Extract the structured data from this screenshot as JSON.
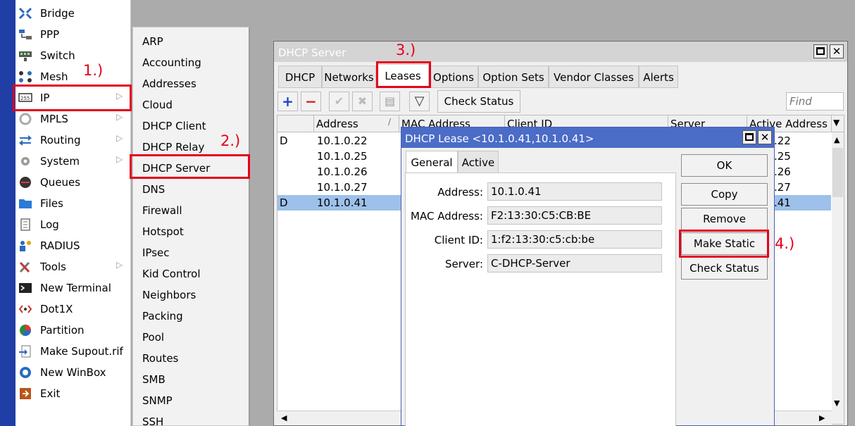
{
  "main_menu": {
    "items": [
      {
        "label": "Bridge",
        "icon": "bridge-icon",
        "submenu": false
      },
      {
        "label": "PPP",
        "icon": "ppp-icon",
        "submenu": false
      },
      {
        "label": "Switch",
        "icon": "switch-icon",
        "submenu": false
      },
      {
        "label": "Mesh",
        "icon": "mesh-icon",
        "submenu": false
      },
      {
        "label": "IP",
        "icon": "ip-icon",
        "submenu": true
      },
      {
        "label": "MPLS",
        "icon": "mpls-icon",
        "submenu": true
      },
      {
        "label": "Routing",
        "icon": "routing-icon",
        "submenu": true
      },
      {
        "label": "System",
        "icon": "gear-icon",
        "submenu": true
      },
      {
        "label": "Queues",
        "icon": "queues-icon",
        "submenu": false
      },
      {
        "label": "Files",
        "icon": "folder-icon",
        "submenu": false
      },
      {
        "label": "Log",
        "icon": "log-icon",
        "submenu": false
      },
      {
        "label": "RADIUS",
        "icon": "radius-icon",
        "submenu": false
      },
      {
        "label": "Tools",
        "icon": "tools-icon",
        "submenu": true
      },
      {
        "label": "New Terminal",
        "icon": "terminal-icon",
        "submenu": false
      },
      {
        "label": "Dot1X",
        "icon": "dot1x-icon",
        "submenu": false
      },
      {
        "label": "Partition",
        "icon": "partition-icon",
        "submenu": false
      },
      {
        "label": "Make Supout.rif",
        "icon": "supout-icon",
        "submenu": false
      },
      {
        "label": "New WinBox",
        "icon": "winbox-icon",
        "submenu": false
      },
      {
        "label": "Exit",
        "icon": "exit-icon",
        "submenu": false
      }
    ],
    "submenu_arrow": "▷"
  },
  "ip_submenu": {
    "items": [
      "ARP",
      "Accounting",
      "Addresses",
      "Cloud",
      "DHCP Client",
      "DHCP Relay",
      "DHCP Server",
      "DNS",
      "Firewall",
      "Hotspot",
      "IPsec",
      "Kid Control",
      "Neighbors",
      "Packing",
      "Pool",
      "Routes",
      "SMB",
      "SNMP",
      "SSH"
    ]
  },
  "dhcp_window": {
    "title": "DHCP Server",
    "tabs": [
      "DHCP",
      "Networks",
      "Leases",
      "Options",
      "Option Sets",
      "Vendor Classes",
      "Alerts"
    ],
    "active_tab": "Leases",
    "toolbar": {
      "add": "+",
      "remove": "−",
      "enable": "✔",
      "disable": "✖",
      "comment": "▤",
      "filter": "▽",
      "check_status": "Check Status",
      "find_placeholder": "Find"
    },
    "columns": [
      "",
      "Address",
      "MAC Address",
      "Client ID",
      "Server",
      "Active Address"
    ],
    "sort_indicator": "/",
    "rows": [
      {
        "flag": "D",
        "address": "10.1.0.22",
        "active": ".22"
      },
      {
        "flag": "",
        "address": "10.1.0.25",
        "active": ".25"
      },
      {
        "flag": "",
        "address": "10.1.0.26",
        "active": ".26"
      },
      {
        "flag": "",
        "address": "10.1.0.27",
        "active": ".27"
      },
      {
        "flag": "D",
        "address": "10.1.0.41",
        "active": ".41"
      }
    ],
    "selected_row": 4
  },
  "lease_dialog": {
    "title": "DHCP Lease <10.1.0.41,10.1.0.41>",
    "tabs": [
      "General",
      "Active"
    ],
    "active_tab": "General",
    "fields": [
      {
        "label": "Address:",
        "value": "10.1.0.41"
      },
      {
        "label": "MAC Address:",
        "value": "F2:13:30:C5:CB:BE"
      },
      {
        "label": "Client ID:",
        "value": "1:f2:13:30:c5:cb:be"
      },
      {
        "label": "Server:",
        "value": "C-DHCP-Server"
      }
    ],
    "buttons": {
      "ok": "OK",
      "copy": "Copy",
      "remove": "Remove",
      "make_static": "Make Static",
      "check_status": "Check Status"
    }
  },
  "annotations": {
    "step1": "1.)",
    "step2": "2.)",
    "step3": "3.)",
    "step4": "4.)"
  },
  "colors": {
    "accent_strip": "#1f3fa6",
    "annotation_red": "#e5001b",
    "selected_row": "#9dc1ea",
    "dialog_titlebar": "#4b6cc7"
  }
}
